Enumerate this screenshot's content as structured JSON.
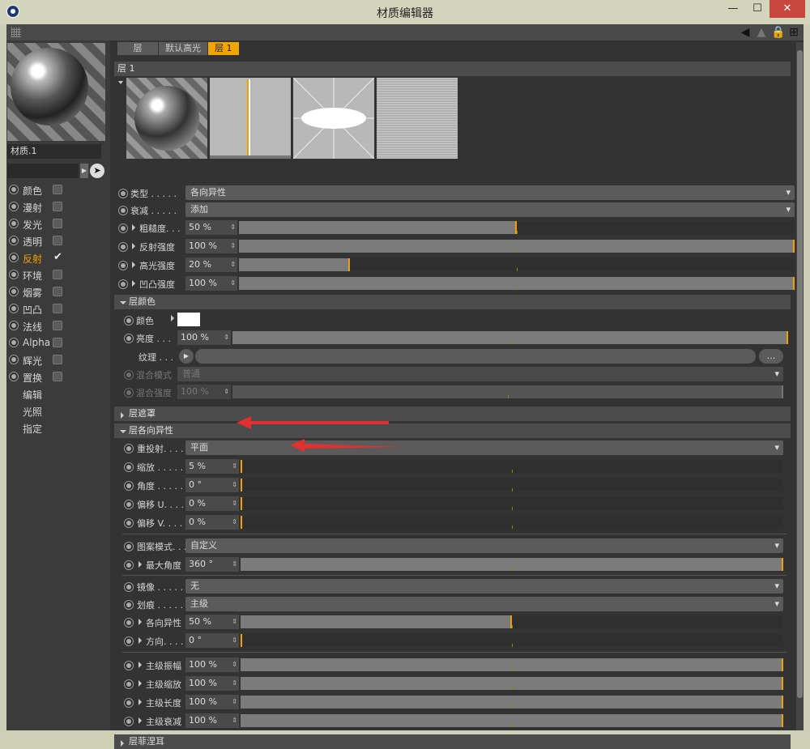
{
  "window": {
    "title": "材质编辑器",
    "minimize": "—",
    "maximize": "☐",
    "close": "✕"
  },
  "material": {
    "name": "材质.1"
  },
  "channels": [
    {
      "label": "颜色",
      "checked": false
    },
    {
      "label": "漫射",
      "checked": false
    },
    {
      "label": "发光",
      "checked": false
    },
    {
      "label": "透明",
      "checked": false
    },
    {
      "label": "反射",
      "checked": true,
      "active": true
    },
    {
      "label": "环境",
      "checked": false
    },
    {
      "label": "烟雾",
      "checked": false
    },
    {
      "label": "凹凸",
      "checked": false
    },
    {
      "label": "法线",
      "checked": false
    },
    {
      "label": "Alpha",
      "checked": false
    },
    {
      "label": "辉光",
      "checked": false
    },
    {
      "label": "置换",
      "checked": false
    }
  ],
  "sub_items": [
    "编辑",
    "光照",
    "指定"
  ],
  "tabs": [
    "层",
    "默认高光",
    "层 1"
  ],
  "layer_title": "层 1",
  "props": {
    "type_label": "类型 . . . . .",
    "type_value": "各向异性",
    "atten_label": "衰减 . . . . .",
    "atten_value": "添加",
    "rough_label": "粗糙度. . .",
    "rough_value": "50 %",
    "rough_fill": 0.5,
    "refl_label": "反射强度",
    "refl_value": "100 %",
    "refl_fill": 1.0,
    "spec_label": "高光强度",
    "spec_value": "20 %",
    "spec_fill": 0.2,
    "bump_label": "凹凸强度",
    "bump_value": "100 %",
    "bump_fill": 1.0
  },
  "layer_color": {
    "header": "层颜色",
    "color_label": "颜色",
    "bright_label": "亮度 . . .",
    "bright_value": "100 %",
    "texture_label": "纹理 . . .",
    "texture_btn": "...",
    "blend_mode_label": "混合模式",
    "blend_mode_value": "普通",
    "blend_strength_label": "混合强度",
    "blend_strength_value": "100 %"
  },
  "layer_mask": {
    "header": "层遮罩"
  },
  "aniso": {
    "header": "层各向异性",
    "reproj_label": "重投射. . . .",
    "reproj_value": "平面",
    "scale_label": "缩放 . . . . .",
    "scale_value": "5 %",
    "scale_fill": 0.0,
    "angle_label": "角度 . . . . .",
    "angle_value": "0 °",
    "offu_label": "偏移 U. . . .",
    "offu_value": "0 %",
    "offv_label": "偏移 V. . . .",
    "offv_value": "0 %",
    "pattern_label": "图案模式. . .",
    "pattern_value": "自定义",
    "maxang_label": "最大角度",
    "maxang_value": "360 °",
    "maxang_fill": 1.0,
    "mirror_label": "镜像 . . . . .",
    "mirror_value": "无",
    "scratch_label": "划痕 . . . . .",
    "scratch_value": "主级",
    "aniso_label": "各向异性",
    "aniso_value": "50 %",
    "aniso_fill": 0.5,
    "dir_label": "方向. . . .",
    "dir_value": "0 °",
    "amp_label": "主级振幅",
    "amp_value": "100 %",
    "scale2_label": "主级缩放",
    "scale2_value": "100 %",
    "len_label": "主级长度",
    "len_value": "100 %",
    "atten2_label": "主级衰减",
    "atten2_value": "100 %"
  },
  "fresnel": {
    "header": "层菲涅耳"
  },
  "colors": {
    "accent": "#f0a000",
    "annotation": "#e03030"
  }
}
